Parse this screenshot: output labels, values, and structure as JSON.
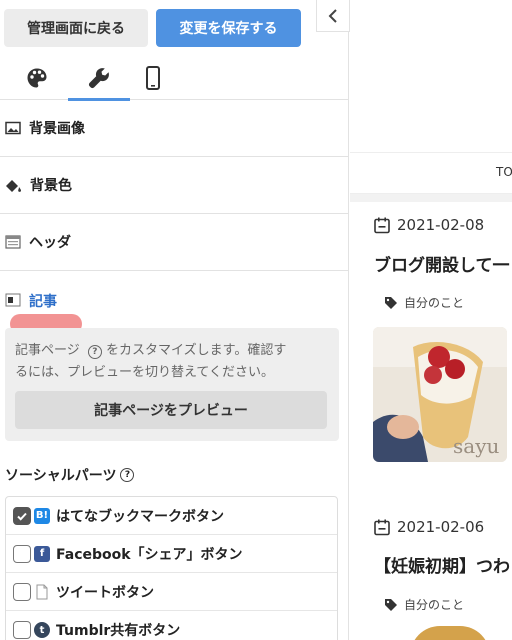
{
  "topbar": {
    "back_label": "管理画面に戻る",
    "save_label": "変更を保存する"
  },
  "tabs": [
    {
      "icon": "palette-icon"
    },
    {
      "icon": "wrench-icon",
      "active": true
    },
    {
      "icon": "mobile-icon"
    }
  ],
  "sections": {
    "background_image": "背景画像",
    "background_color": "背景色",
    "header": "ヘッダ",
    "article": "記事"
  },
  "article_info": {
    "description": "記事ページ ⓘ をカスタマイズします。確認するには、プレビューを切り替えてください。",
    "desc_part1": "記事ページ",
    "desc_part2": "をカスタマイズします。確認す",
    "desc_part3": "るには、プレビューを切り替えてください。",
    "preview_button": "記事ページをプレビュー"
  },
  "social": {
    "title": "ソーシャルパーツ",
    "items": [
      {
        "label": "はてなブックマークボタン",
        "checked": true,
        "service_icon": "hatena-icon",
        "color": "#1e88e5"
      },
      {
        "label": "Facebook「シェア」ボタン",
        "checked": false,
        "service_icon": "facebook-icon",
        "color": "#3b5998"
      },
      {
        "label": "ツイートボタン",
        "checked": false,
        "service_icon": "document-icon",
        "color": "#ffffff"
      },
      {
        "label": "Tumblr共有ボタン",
        "checked": false,
        "service_icon": "tumblr-icon",
        "color": "#35465c"
      }
    ]
  },
  "preview": {
    "nav_item": "TO",
    "posts": [
      {
        "date": "2021-02-08",
        "title": "ブログ開設して一",
        "tag": "自分のこと",
        "watermark": "sayu"
      },
      {
        "date": "2021-02-06",
        "title": "【妊娠初期】つわ",
        "tag": "自分のこと"
      }
    ]
  },
  "colors": {
    "accent": "#4f92e1",
    "active_link": "#2e6fc9",
    "marker": "#f08080"
  }
}
